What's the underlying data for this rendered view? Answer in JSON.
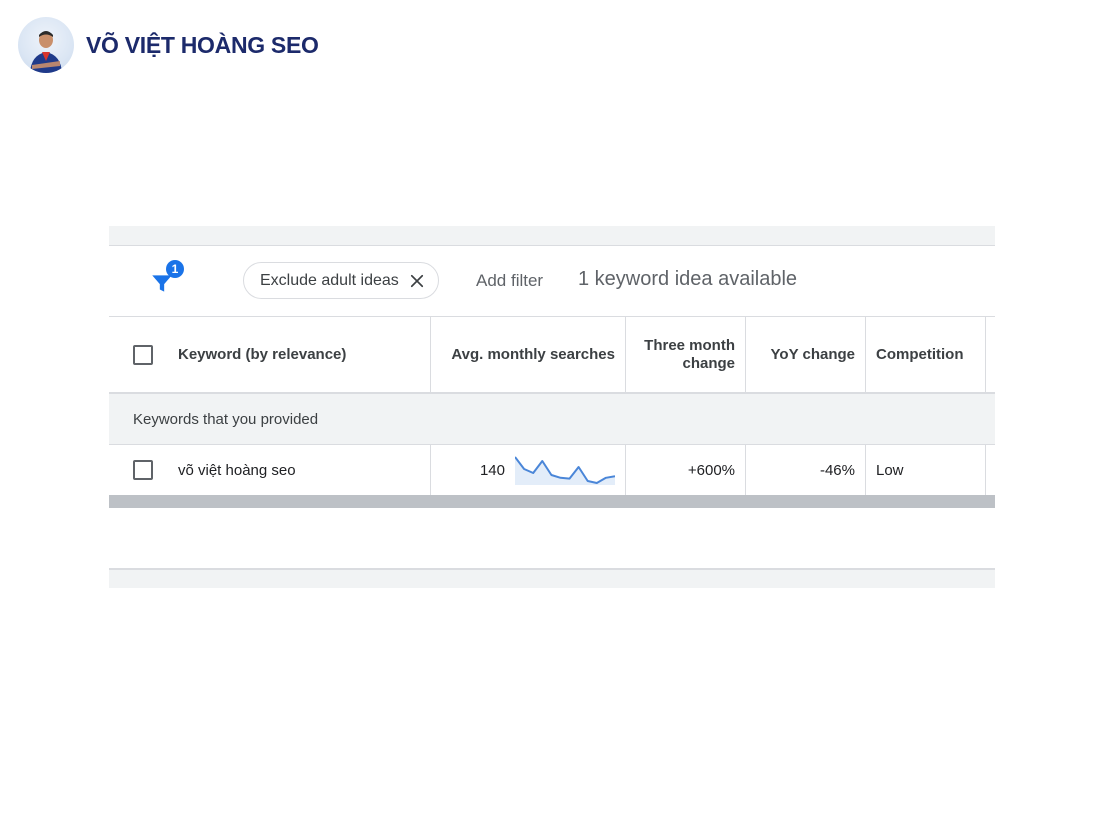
{
  "brand": {
    "name": "VÕ VIỆT HOÀNG SEO",
    "avatar_icon": "person-avatar-icon"
  },
  "filter_bar": {
    "filter_icon": "funnel-icon",
    "filter_count": "1",
    "chip_label": "Exclude adult ideas",
    "chip_close_icon": "close-icon",
    "add_filter": "Add filter",
    "idea_count": "1 keyword idea available"
  },
  "table": {
    "headers": {
      "keyword": "Keyword (by relevance)",
      "avg_searches": "Avg. monthly searches",
      "three_month": "Three month change",
      "yoy": "YoY change",
      "competition": "Competition"
    },
    "group_label": "Keywords that you provided",
    "rows": [
      {
        "keyword": "võ việt hoàng seo",
        "avg_searches": "140",
        "trend": [
          10,
          40,
          50,
          20,
          55,
          62,
          64,
          35,
          70,
          75,
          62,
          58
        ],
        "three_month": "+600%",
        "yoy": "-46%",
        "competition": "Low"
      }
    ]
  },
  "colors": {
    "accent": "#1a73e8",
    "brand_text": "#1c2a6b",
    "sparkline": "#4a86d8",
    "sparkline_fill": "#e3edf9"
  }
}
